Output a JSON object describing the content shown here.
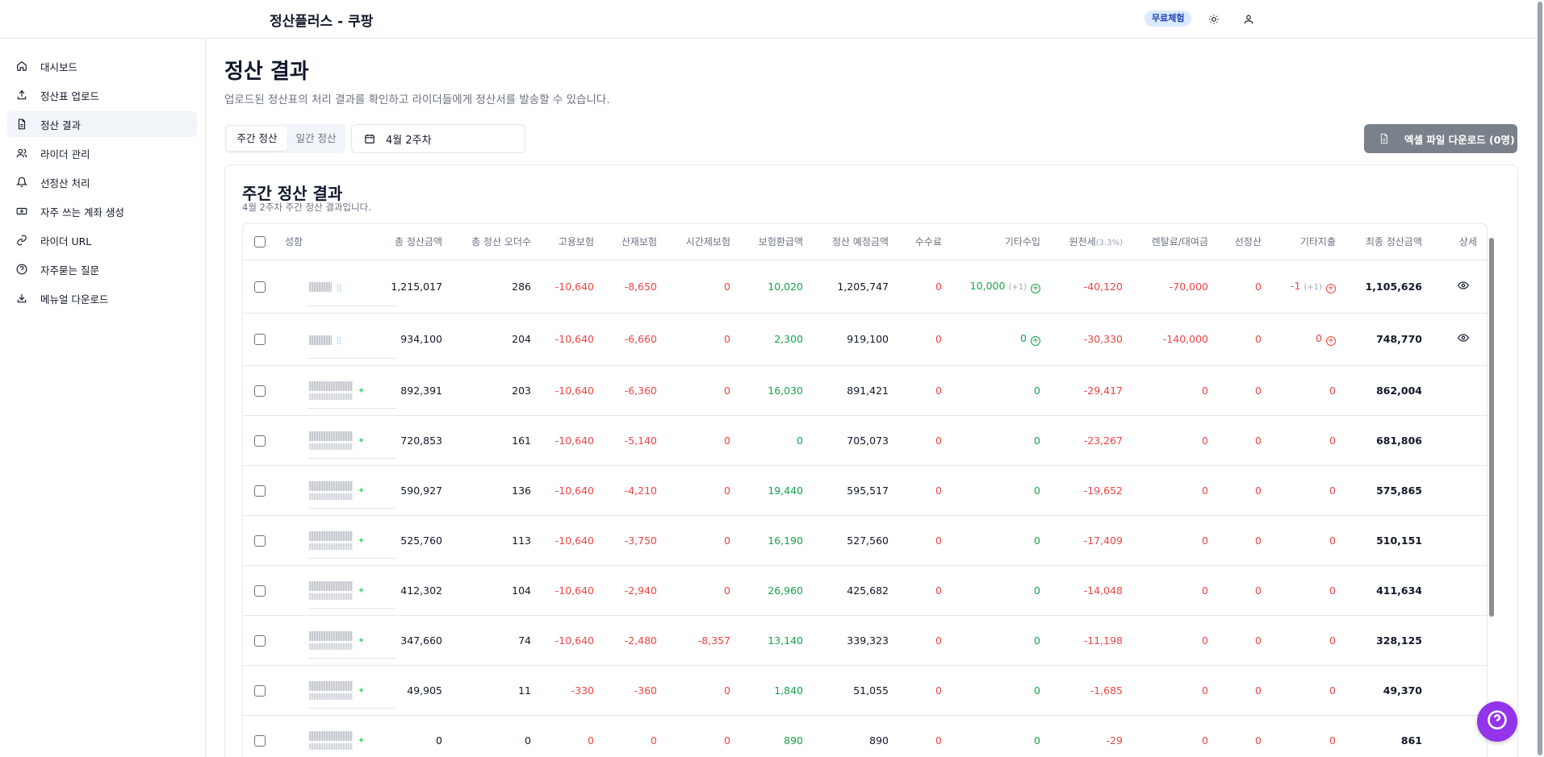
{
  "header": {
    "title": "정산플러스 - 쿠팡",
    "trial_badge": "무료체험"
  },
  "sidebar": {
    "items": [
      {
        "label": "대시보드",
        "icon": "home-icon"
      },
      {
        "label": "정산표 업로드",
        "icon": "upload-icon"
      },
      {
        "label": "정산 결과",
        "icon": "file-icon",
        "active": true
      },
      {
        "label": "라이더 관리",
        "icon": "users-icon"
      },
      {
        "label": "선정산 처리",
        "icon": "bell-icon"
      },
      {
        "label": "자주 쓰는 계좌 생성",
        "icon": "bank-icon"
      },
      {
        "label": "라이더 URL",
        "icon": "link-icon"
      },
      {
        "label": "자주묻는 질문",
        "icon": "help-circle-icon"
      },
      {
        "label": "메뉴얼 다운로드",
        "icon": "download-icon"
      }
    ]
  },
  "main": {
    "title": "정산 결과",
    "description": "업로드된 정산표의 처리 결과를 확인하고 라이더들에게 정산서를 발송할 수 있습니다.",
    "toggle": {
      "weekly": "주간 정산",
      "daily": "일간 정산"
    },
    "week_select": "4월 2주차",
    "excel_button": "엑셀 파일 다운로드 (0명)"
  },
  "card": {
    "title": "주간 정산 결과",
    "subtitle": "4월 2주차 주간 정산 결과입니다.",
    "columns": {
      "name": "성함",
      "total_amount": "총 정산금액",
      "total_orders": "총 정산 오더수",
      "employment_ins": "고용보험",
      "industrial_ins": "산재보험",
      "hourly_ins": "시간제보험",
      "ins_refund": "보험환급액",
      "expected": "정산 예정금액",
      "fee": "수수료",
      "other_income": "기타수입",
      "withholding": "원천세",
      "withholding_rate": "(3.3%)",
      "rental": "렌탈료/대여금",
      "advance": "선정산",
      "other_expense": "기타지출",
      "final": "최종 정산금액",
      "detail": "상세"
    },
    "rows": [
      {
        "total": "1,215,017",
        "orders": "286",
        "emp": "-10,640",
        "ind": "-8,650",
        "hour": "0",
        "refund": "10,020",
        "expected": "1,205,747",
        "fee": "0",
        "other_in": "10,000",
        "other_in_note": "(+1)",
        "wh": "-40,120",
        "rental": "-70,000",
        "adv": "0",
        "other_out": "-1",
        "other_out_note": "(+1)",
        "final": "1,105,626"
      },
      {
        "total": "934,100",
        "orders": "204",
        "emp": "-10,640",
        "ind": "-6,660",
        "hour": "0",
        "refund": "2,300",
        "expected": "919,100",
        "fee": "0",
        "other_in": "0",
        "wh": "-30,330",
        "rental": "-140,000",
        "adv": "0",
        "other_out": "0",
        "final": "748,770"
      },
      {
        "total": "892,391",
        "orders": "203",
        "emp": "-10,640",
        "ind": "-6,360",
        "hour": "0",
        "refund": "16,030",
        "expected": "891,421",
        "fee": "0",
        "other_in": "0",
        "wh": "-29,417",
        "rental": "0",
        "adv": "0",
        "other_out": "0",
        "final": "862,004"
      },
      {
        "total": "720,853",
        "orders": "161",
        "emp": "-10,640",
        "ind": "-5,140",
        "hour": "0",
        "refund": "0",
        "expected": "705,073",
        "fee": "0",
        "other_in": "0",
        "wh": "-23,267",
        "rental": "0",
        "adv": "0",
        "other_out": "0",
        "final": "681,806"
      },
      {
        "total": "590,927",
        "orders": "136",
        "emp": "-10,640",
        "ind": "-4,210",
        "hour": "0",
        "refund": "19,440",
        "expected": "595,517",
        "fee": "0",
        "other_in": "0",
        "wh": "-19,652",
        "rental": "0",
        "adv": "0",
        "other_out": "0",
        "final": "575,865"
      },
      {
        "total": "525,760",
        "orders": "113",
        "emp": "-10,640",
        "ind": "-3,750",
        "hour": "0",
        "refund": "16,190",
        "expected": "527,560",
        "fee": "0",
        "other_in": "0",
        "wh": "-17,409",
        "rental": "0",
        "adv": "0",
        "other_out": "0",
        "final": "510,151"
      },
      {
        "total": "412,302",
        "orders": "104",
        "emp": "-10,640",
        "ind": "-2,940",
        "hour": "0",
        "refund": "26,960",
        "expected": "425,682",
        "fee": "0",
        "other_in": "0",
        "wh": "-14,048",
        "rental": "0",
        "adv": "0",
        "other_out": "0",
        "final": "411,634"
      },
      {
        "total": "347,660",
        "orders": "74",
        "emp": "-10,640",
        "ind": "-2,480",
        "hour": "-8,357",
        "refund": "13,140",
        "expected": "339,323",
        "fee": "0",
        "other_in": "0",
        "wh": "-11,198",
        "rental": "0",
        "adv": "0",
        "other_out": "0",
        "final": "328,125"
      },
      {
        "total": "49,905",
        "orders": "11",
        "emp": "-330",
        "ind": "-360",
        "hour": "0",
        "refund": "1,840",
        "expected": "51,055",
        "fee": "0",
        "other_in": "0",
        "wh": "-1,685",
        "rental": "0",
        "adv": "0",
        "other_out": "0",
        "final": "49,370"
      },
      {
        "total": "0",
        "orders": "0",
        "emp": "0",
        "ind": "0",
        "hour": "0",
        "refund": "890",
        "expected": "890",
        "fee": "0",
        "other_in": "0",
        "wh": "-29",
        "rental": "0",
        "adv": "0",
        "other_out": "0",
        "final": "861"
      }
    ]
  },
  "colors": {
    "negative": "#ef4444",
    "positive": "#16a34a",
    "accent": "#9333ea"
  }
}
